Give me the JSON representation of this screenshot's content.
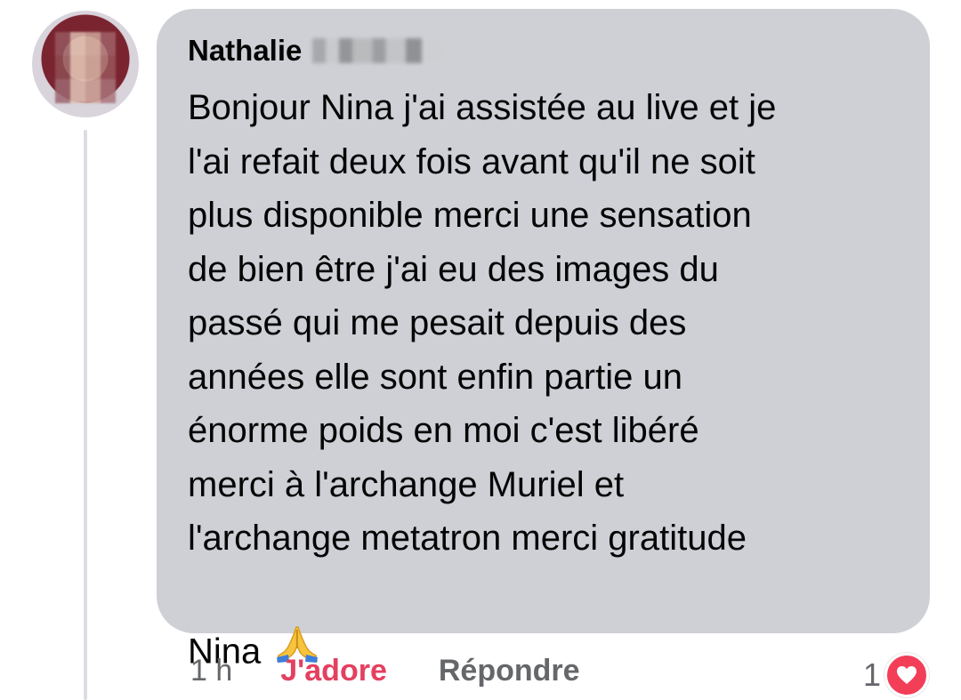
{
  "comment": {
    "author": "Nathalie",
    "text": "Bonjour Nina j'ai assistée au live et je\nl'ai refait deux fois avant qu'il ne soit\nplus disponible merci une sensation\nde bien être j'ai eu des images du\npassé qui me pesait depuis des\nannées elle sont enfin partie un\nénorme poids en moi c'est libéré\nmerci à l'archange Muriel et\nl'archange metatron merci gratitude\nNina",
    "emoji": "🙏",
    "time": "1 h",
    "reaction_action_label": "J'adore",
    "reply_label": "Répondre",
    "reaction_count": "1",
    "reaction_icon": "heart-icon",
    "colors": {
      "bubble": "#ced0d6",
      "reaction_active": "#e4405f",
      "muted": "#65676b",
      "heart": "#f33e58"
    }
  }
}
